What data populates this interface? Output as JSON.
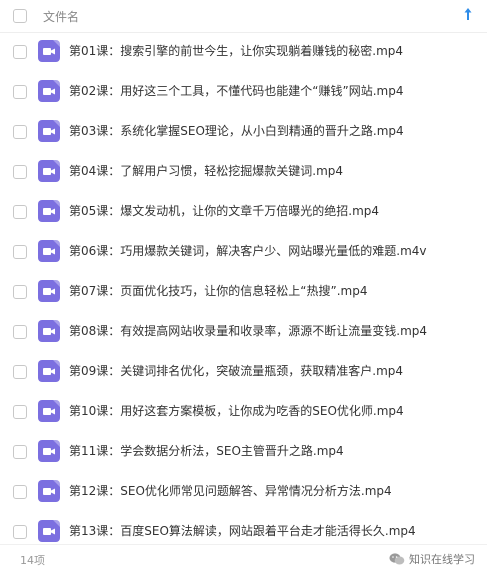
{
  "header": {
    "column_title": "文件名",
    "sort_icon": "arrow-up-icon"
  },
  "files": [
    {
      "name": "第01课：搜索引擎的前世今生，让你实现躺着赚钱的秘密.mp4"
    },
    {
      "name": "第02课：用好这三个工具，不懂代码也能建个“赚钱”网站.mp4"
    },
    {
      "name": "第03课：系统化掌握SEO理论，从小白到精通的晋升之路.mp4"
    },
    {
      "name": "第04课：了解用户习惯，轻松挖掘爆款关键词.mp4"
    },
    {
      "name": "第05课：爆文发动机，让你的文章千万倍曝光的绝招.mp4"
    },
    {
      "name": "第06课：巧用爆款关键词，解决客户少、网站曝光量低的难题.m4v"
    },
    {
      "name": "第07课：页面优化技巧，让你的信息轻松上“热搜”.mp4"
    },
    {
      "name": "第08课：有效提高网站收录量和收录率，源源不断让流量变钱.mp4"
    },
    {
      "name": "第09课：关键词排名优化，突破流量瓶颈，获取精准客户.mp4"
    },
    {
      "name": "第10课：用好这套方案模板，让你成为吃香的SEO优化师.mp4"
    },
    {
      "name": "第11课：学会数据分析法，SEO主管晋升之路.mp4"
    },
    {
      "name": "第12课：SEO优化师常见问题解答、异常情况分析方法.mp4"
    },
    {
      "name": "第13课：百度SEO算法解读，网站跟着平台走才能活得长久.mp4"
    }
  ],
  "footer": {
    "count": "14项",
    "watermark": "知识在线学习"
  },
  "colors": {
    "video_icon": "#7b6fe0",
    "sort_arrow": "#2f8ce8"
  }
}
